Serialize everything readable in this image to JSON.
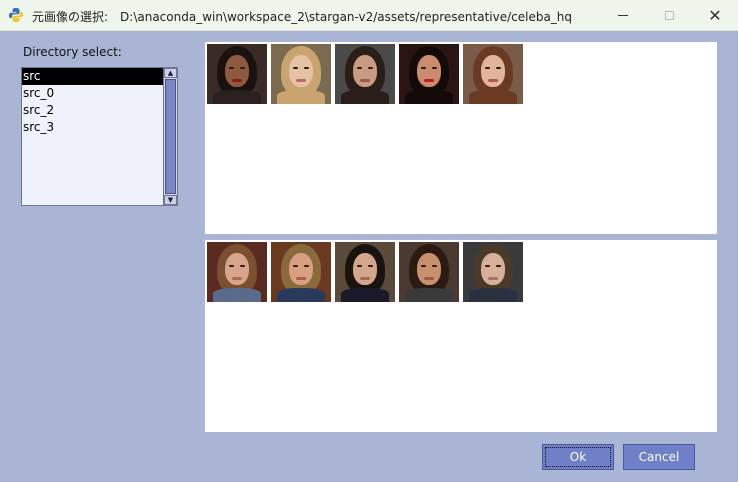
{
  "window": {
    "title": "元画像の選択:　D:\\anaconda_win\\workspace_2\\stargan-v2/assets/representative/celeba_hq",
    "icon": "python-icon"
  },
  "directory": {
    "label": "Directory select:",
    "items": [
      "src",
      "src_0",
      "src_2",
      "src_3"
    ],
    "selected": "src"
  },
  "panels": {
    "top": {
      "thumbnails": [
        {
          "icon": "face-thumbnail",
          "bg": "#3a2b26",
          "hair": "#1a120e",
          "skin": "#8d5a3f",
          "lip": "#8a1a1a",
          "shirt": "#2a201d"
        },
        {
          "icon": "face-thumbnail",
          "bg": "#7a6a50",
          "hair": "#c9a46e",
          "skin": "#e6c2a4",
          "lip": "#b86a66",
          "shirt": "#c9a46e"
        },
        {
          "icon": "face-thumbnail",
          "bg": "#4a4a4a",
          "hair": "#2a1e18",
          "skin": "#c99c82",
          "lip": "#9a5a52",
          "shirt": "#2a1e18"
        },
        {
          "icon": "face-thumbnail",
          "bg": "#2a1512",
          "hair": "#140a08",
          "skin": "#c98c6e",
          "lip": "#c41a22",
          "shirt": "#140a08"
        },
        {
          "icon": "face-thumbnail",
          "bg": "#7a5a48",
          "hair": "#6a3a22",
          "skin": "#e2b49a",
          "lip": "#b05a52",
          "shirt": "#6a3a22"
        }
      ]
    },
    "bottom": {
      "thumbnails": [
        {
          "icon": "face-thumbnail",
          "bg": "#5a2a20",
          "hair": "#7a5030",
          "skin": "#d8a48a",
          "lip": "#a86a5c",
          "shirt": "#5a6a8a"
        },
        {
          "icon": "face-thumbnail",
          "bg": "#6a3a20",
          "hair": "#8a6a3a",
          "skin": "#d8a080",
          "lip": "#a8604c",
          "shirt": "#2a3a5a"
        },
        {
          "icon": "face-thumbnail",
          "bg": "#5a4a3a",
          "hair": "#1a1410",
          "skin": "#d4a68c",
          "lip": "#a06a5a",
          "shirt": "#1a1a2a"
        },
        {
          "icon": "face-thumbnail",
          "bg": "#4a3a30",
          "hair": "#2a1a12",
          "skin": "#c9906e",
          "lip": "#9a5a48",
          "shirt": "#3a3a3a"
        },
        {
          "icon": "face-thumbnail",
          "bg": "#3a3a3a",
          "hair": "#4a3a2a",
          "skin": "#d8b09a",
          "lip": "#a8706a",
          "shirt": "#2a3040"
        }
      ]
    }
  },
  "buttons": {
    "ok": "Ok",
    "cancel": "Cancel"
  },
  "colors": {
    "window_bg": "#aab4d4",
    "button_bg": "#6f7fc8",
    "scroll_thumb": "#7d86c4"
  }
}
